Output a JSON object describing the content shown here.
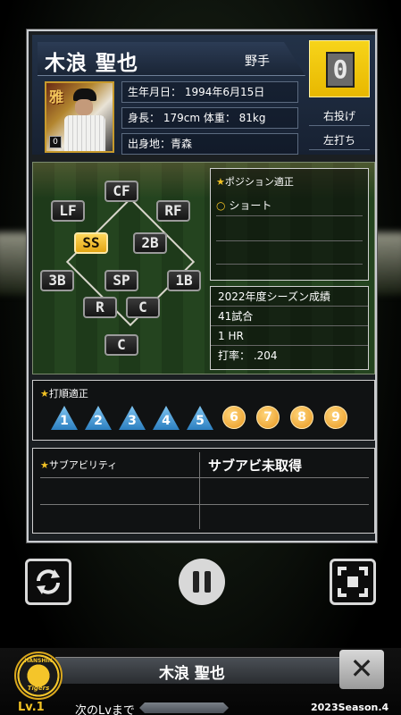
{
  "player": {
    "name": "木浪 聖也",
    "position": "野手",
    "number": "0",
    "throws": "右投げ",
    "bats": "左打ち",
    "birthdate": "生年月日： 1994年6月15日",
    "height_weight": "身長： 179cm 体重： 81kg",
    "hometown": "出身地：青森",
    "portrait_caption": "雅"
  },
  "positions": {
    "title": "ポジション適正",
    "buttons": [
      "CF",
      "LF",
      "RF",
      "SS",
      "2B",
      "3B",
      "SP",
      "1B",
      "R",
      "C",
      "C"
    ],
    "active": "SS",
    "aptitude_items": [
      {
        "mark": "○",
        "label": "ショート"
      }
    ]
  },
  "stats": {
    "season": "2022年度シーズン成績",
    "games": "41試合",
    "hr": "1 HR",
    "avg": "打率： .204"
  },
  "batting_order": {
    "title": "打順適正",
    "suitable": [
      "1",
      "2",
      "3",
      "4",
      "5"
    ],
    "other": [
      "6",
      "7",
      "8",
      "9"
    ]
  },
  "sub_ability": {
    "title": "サブアビリティ",
    "value": "サブアビ未取得"
  },
  "controls": {
    "refresh_icon": "refresh-icon",
    "pause_icon": "pause-icon",
    "shrink_icon": "shrink-icon"
  },
  "bottom": {
    "team_logo_top": "HANSHIN",
    "team_logo_bottom": "Tigers",
    "name": "木浪 聖也",
    "close": "✕",
    "level": "Lv.1",
    "next_level": "次のLvまで",
    "season": "2023Season.4"
  },
  "colors": {
    "accent_yellow": "#f2c224",
    "number_box": "#f7d41a",
    "triangle_blue": "#2c7fc0",
    "circle_orange": "#e8961e"
  }
}
